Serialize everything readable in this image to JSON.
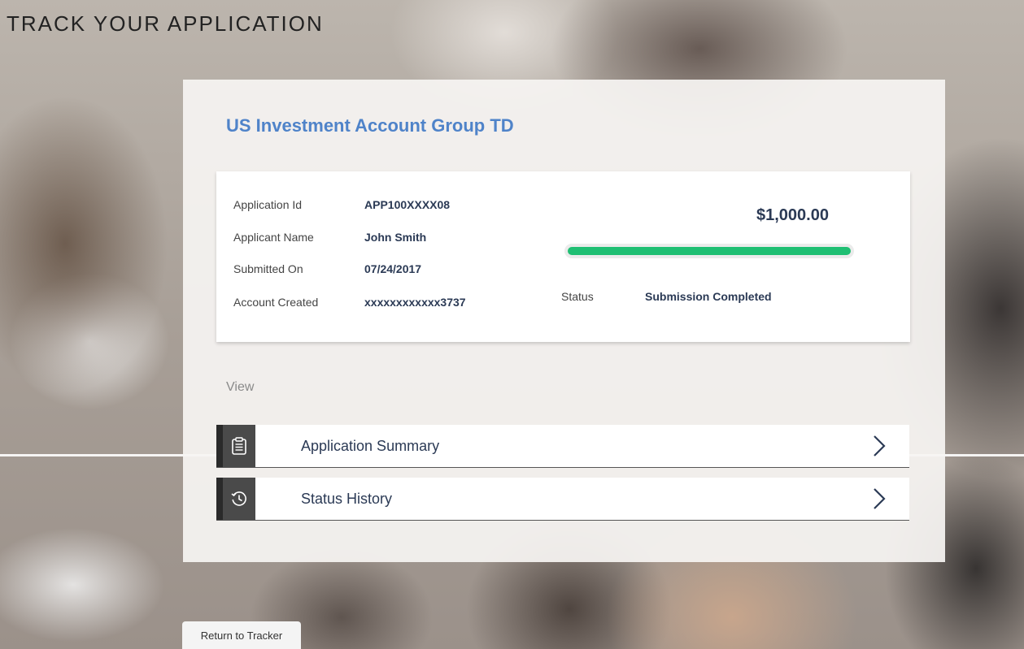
{
  "page": {
    "title": "TRACK YOUR APPLICATION"
  },
  "card": {
    "title": "US Investment Account Group TD",
    "details": [
      {
        "label": "Application Id",
        "value": "APP100XXXX08"
      },
      {
        "label": "Applicant Name",
        "value": "John Smith"
      },
      {
        "label": "Submitted On",
        "value": "07/24/2017"
      },
      {
        "label": "Account Created",
        "value": "xxxxxxxxxxxx3737"
      }
    ],
    "amount": "$1,000.00",
    "progress_fraction": 1.0,
    "progress_color": "#1fbf73",
    "status_label": "Status",
    "status_value": "Submission Completed"
  },
  "view": {
    "heading": "View",
    "items": [
      {
        "label": "Application Summary",
        "icon": "clipboard-icon"
      },
      {
        "label": "Status History",
        "icon": "history-clock-icon"
      }
    ]
  },
  "footer": {
    "return_label": "Return to Tracker"
  },
  "colors": {
    "title_blue": "#4f83c9",
    "text_navy": "#2b3a55",
    "icon_bg": "#4a4a4a"
  }
}
